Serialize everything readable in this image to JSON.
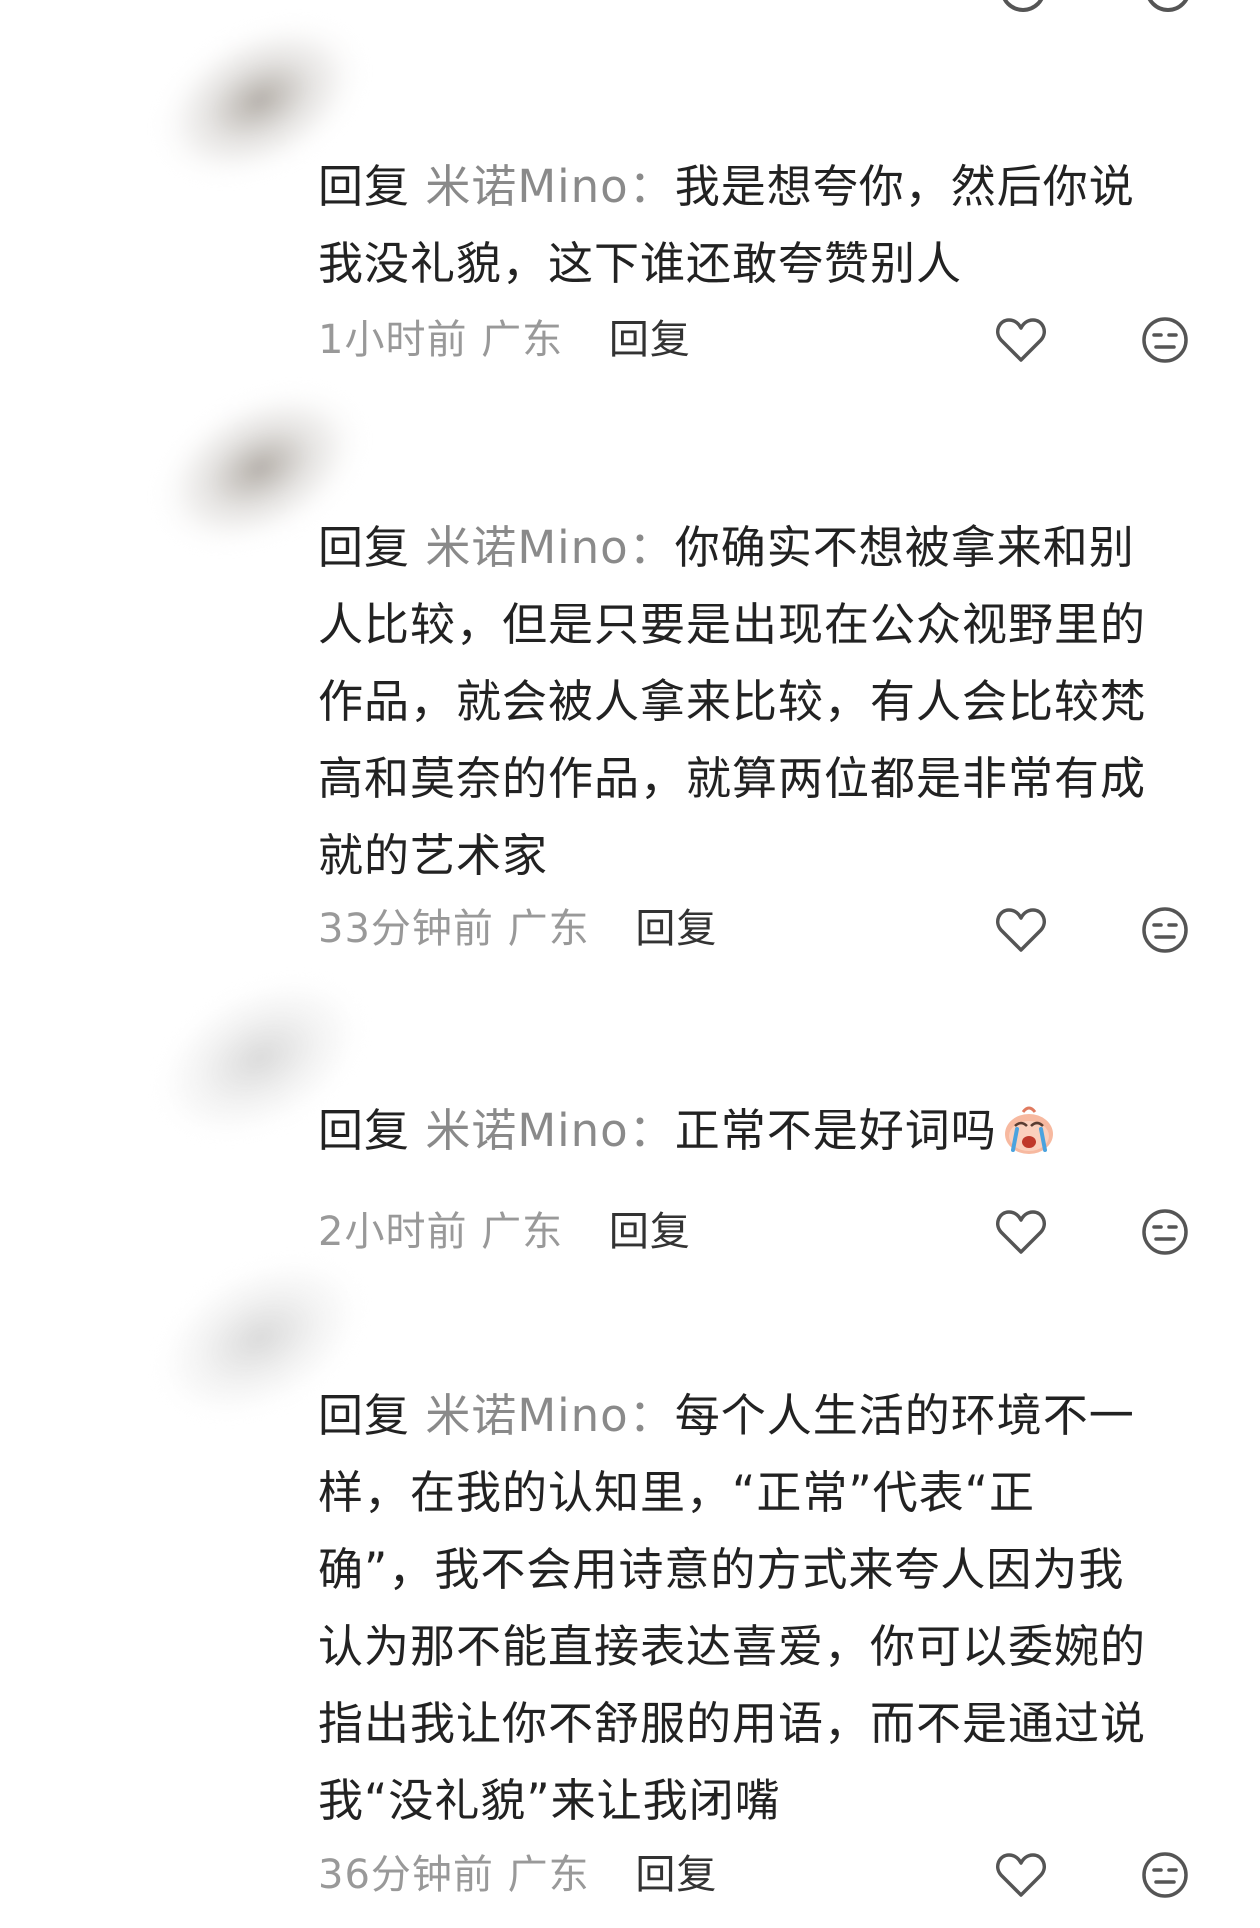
{
  "comments": [
    {
      "reply_prefix": "回复",
      "user": "米诺Mino",
      "separator": "：",
      "lines": [
        "我是想夸你，然后你说",
        "我没礼貌，这下谁还敢夸赞别人"
      ],
      "time": "1小时前",
      "location": "广东",
      "reply_label": "回复"
    },
    {
      "reply_prefix": "回复",
      "user": "米诺Mino",
      "separator": "：",
      "lines": [
        "你确实不想被拿来和别",
        "人比较，但是只要是出现在公众视野里的",
        "作品，就会被人拿来比较，有人会比较梵",
        "高和莫奈的作品，就算两位都是非常有成",
        "就的艺术家"
      ],
      "time": "33分钟前",
      "location": "广东",
      "reply_label": "回复"
    },
    {
      "reply_prefix": "回复",
      "user": "米诺Mino",
      "separator": "：",
      "lines": [
        "正常不是好词吗"
      ],
      "emoji": "crying-face-emoji",
      "time": "2小时前",
      "location": "广东",
      "reply_label": "回复"
    },
    {
      "reply_prefix": "回复",
      "user": "米诺Mino",
      "separator": "：",
      "lines": [
        "每个人生活的环境不一",
        "样，在我的认知里，“正常”代表“正",
        "确”，我不会用诗意的方式来夸人因为我",
        "认为那不能直接表达喜爱，你可以委婉的",
        "指出我让你不舒服的用语，而不是通过说",
        "我“没礼貌”来让我闭嘴"
      ],
      "time": "36分钟前",
      "location": "广东",
      "reply_label": "回复"
    }
  ],
  "icons": {
    "like": "heart-outline-icon",
    "dislike": "neutral-face-icon"
  },
  "colors": {
    "text": "#222222",
    "username": "#8a8a8a",
    "meta": "#999999",
    "icon": "#555555"
  }
}
